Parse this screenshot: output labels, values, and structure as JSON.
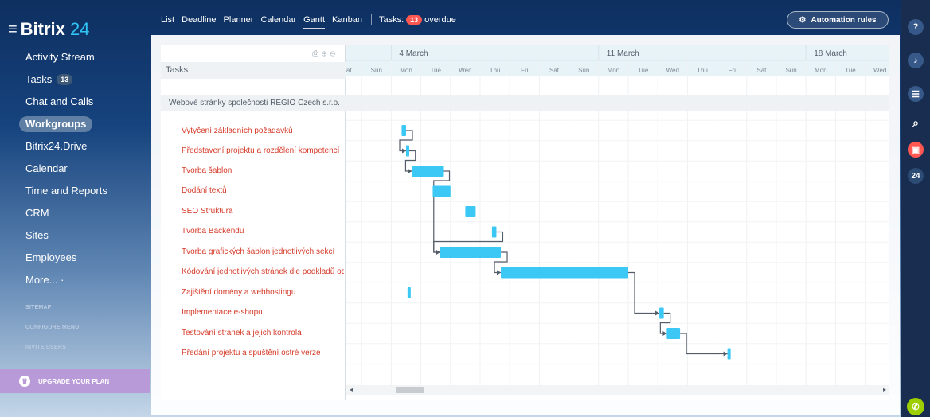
{
  "logo": {
    "name": "Bitrix",
    "number": "24"
  },
  "sidebar": {
    "items": [
      {
        "label": "Activity Stream"
      },
      {
        "label": "Tasks",
        "badge": "13"
      },
      {
        "label": "Chat and Calls"
      },
      {
        "label": "Workgroups",
        "active": true
      },
      {
        "label": "Bitrix24.Drive"
      },
      {
        "label": "Calendar"
      },
      {
        "label": "Time and Reports"
      },
      {
        "label": "CRM"
      },
      {
        "label": "Sites"
      },
      {
        "label": "Employees"
      },
      {
        "label": "More... ·"
      }
    ],
    "links": [
      "SITEMAP",
      "CONFIGURE MENU",
      "INVITE USERS"
    ],
    "upgrade": "UPGRADE YOUR PLAN"
  },
  "topnav": {
    "tabs": [
      "List",
      "Deadline",
      "Planner",
      "Calendar",
      "Gantt",
      "Kanban"
    ],
    "active_tab": "Gantt",
    "tasks_label": "Tasks:",
    "tasks_count": "13",
    "overdue_label": "overdue",
    "automation": "Automation rules"
  },
  "rail": {
    "count": "24"
  },
  "tasks_panel": {
    "header": "Tasks",
    "group": "Webové stránky společnosti REGIO Czech s.r.o.",
    "tasks": [
      "Vytyčení základních požadavků",
      "Představení projektu a rozdělení kompetencí",
      "Tvorba šablon",
      "Dodání textů",
      "SEO Struktura",
      "Tvorba Backendu",
      "Tvorba grafických šablon jednotlivých sekcí",
      "Kódování jednotlivých stránek dle podkladů od",
      "Zajištění domény a webhostingu",
      "Implementace e-shopu",
      "Testování stránek a jejich kontrola",
      "Předání projektu a spuštění ostré verze"
    ]
  },
  "gantt": {
    "weeks": [
      {
        "label": "4 March",
        "day_index": 2
      },
      {
        "label": "11 March",
        "day_index": 9
      },
      {
        "label": "18 March",
        "day_index": 16
      }
    ],
    "days": [
      "Sat",
      "Sun",
      "Mon",
      "Tue",
      "Wed",
      "Thu",
      "Fri",
      "Sat",
      "Sun",
      "Mon",
      "Tue",
      "Wed",
      "Thu",
      "Fri",
      "Sat",
      "Sun",
      "Mon",
      "Tue",
      "Wed"
    ],
    "bars": [
      {
        "task": 0,
        "start": 2.35,
        "end": 2.5
      },
      {
        "task": 1,
        "start": 2.5,
        "end": 2.6
      },
      {
        "task": 2,
        "start": 2.7,
        "end": 3.75
      },
      {
        "task": 3,
        "start": 3.4,
        "end": 4.0
      },
      {
        "task": 4,
        "start": 4.5,
        "end": 4.85
      },
      {
        "task": 5,
        "start": 5.4,
        "end": 5.55
      },
      {
        "task": 6,
        "start": 3.65,
        "end": 5.7
      },
      {
        "task": 7,
        "start": 5.7,
        "end": 10.0
      },
      {
        "task": 8,
        "start": 2.55,
        "end": 2.62
      },
      {
        "task": 9,
        "start": 11.05,
        "end": 11.2
      },
      {
        "task": 10,
        "start": 11.3,
        "end": 11.75
      },
      {
        "task": 11,
        "start": 13.35,
        "end": 13.45
      }
    ],
    "links": [
      [
        0,
        1
      ],
      [
        1,
        2
      ],
      [
        2,
        6
      ],
      [
        5,
        6
      ],
      [
        6,
        7
      ],
      [
        7,
        9
      ],
      [
        9,
        10
      ],
      [
        10,
        11
      ]
    ],
    "bar_color": "#3bc8f5"
  }
}
